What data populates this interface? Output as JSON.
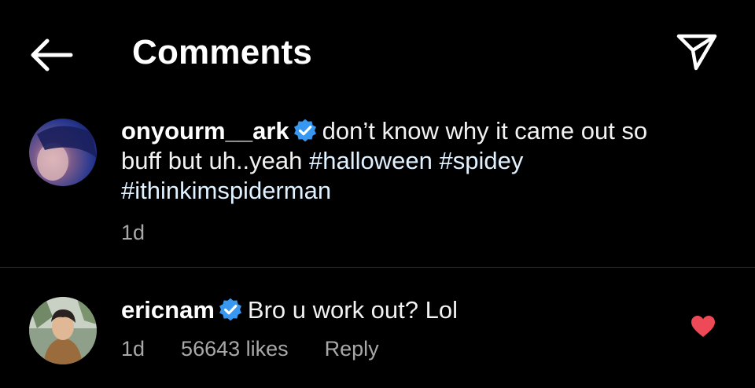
{
  "header": {
    "title": "Comments",
    "back_icon": "arrow-left-icon",
    "send_icon": "paper-plane-icon"
  },
  "caption": {
    "username": "onyourm__ark",
    "verified": true,
    "text_plain": "don’t know why it came out so buff but uh..yeah",
    "hashtags": [
      "#halloween",
      "#spidey",
      "#ithinkimspiderman"
    ],
    "time": "1d"
  },
  "comment": {
    "username": "ericnam",
    "verified": true,
    "text": "Bro u work out? Lol",
    "time": "1d",
    "likes": "56643 likes",
    "reply_label": "Reply",
    "liked": true
  },
  "colors": {
    "background": "#000000",
    "verified_badge": "#3897f0",
    "heart": "#ed4956",
    "hashtag": "#e0f1ff",
    "secondary_text": "#a8a8a8"
  }
}
